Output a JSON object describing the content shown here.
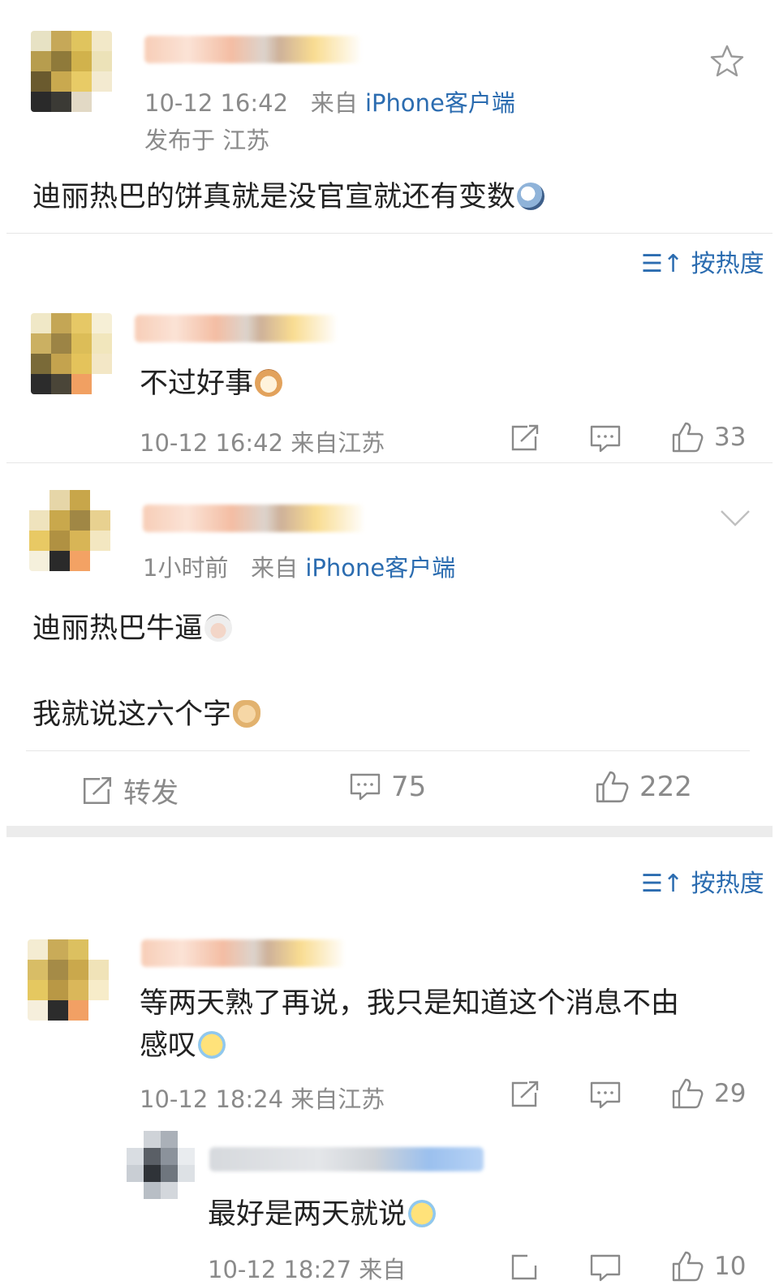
{
  "post": {
    "author_name": "",
    "time": "10-12 16:42",
    "source_prefix": "来自",
    "source": "iPhone客户端",
    "location": "发布于 江苏",
    "content": "迪丽热巴的饼真就是没官宣就还有变数",
    "star_icon": "star-icon"
  },
  "sort_label": "按热度",
  "comments": [
    {
      "text": "不过好事",
      "time": "10-12 16:42",
      "location": "来自江苏",
      "likes": "33"
    }
  ],
  "reply_post": {
    "time": "1小时前",
    "source_prefix": "来自",
    "source": "iPhone客户端",
    "line1": "迪丽热巴牛逼",
    "line2": "我就说这六个字",
    "repost_label": "转发",
    "comment_count": "75",
    "like_count": "222"
  },
  "sort_label_2": "按热度",
  "comments_2": [
    {
      "text_line1": "等两天熟了再说，我只是知道这个消息不由",
      "text_line2": "感叹",
      "time": "10-12 18:24",
      "location": "来自江苏",
      "likes": "29"
    }
  ],
  "sub_reply": {
    "text": "最好是两天就说",
    "time_partial": "10-12 18:27",
    "location_partial": "来自",
    "likes_partial": "10"
  },
  "colors": {
    "link": "#2b6cb0",
    "meta": "#8a8a8a",
    "divider": "#e6e6e6"
  }
}
